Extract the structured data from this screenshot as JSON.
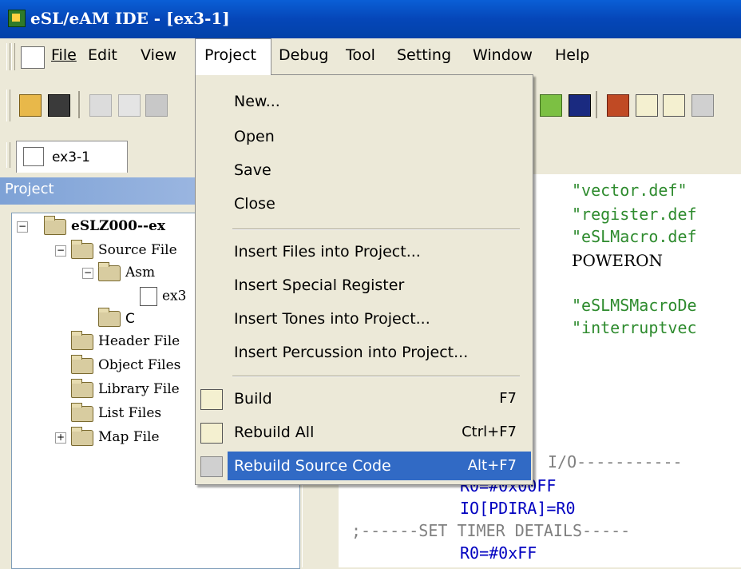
{
  "window": {
    "title": "eSL/eAM IDE - [ex3-1]"
  },
  "menubar": {
    "items": [
      "File",
      "Edit",
      "View",
      "Project",
      "Debug",
      "Tool",
      "Setting",
      "Window",
      "Help"
    ]
  },
  "doc_tab": {
    "label": "ex3-1"
  },
  "project_pane": {
    "title": "Project",
    "tree": [
      {
        "label": "eSLZ000--ex",
        "level": 0,
        "type": "folder",
        "expander": "−"
      },
      {
        "label": "Source File",
        "level": 1,
        "type": "folder",
        "expander": "−"
      },
      {
        "label": "Asm",
        "level": 2,
        "type": "folder",
        "expander": "−"
      },
      {
        "label": "ex3",
        "level": 3,
        "type": "file"
      },
      {
        "label": "C",
        "level": 2,
        "type": "folder"
      },
      {
        "label": "Header File",
        "level": 1,
        "type": "folder"
      },
      {
        "label": "Object Files",
        "level": 1,
        "type": "folder"
      },
      {
        "label": "Library File",
        "level": 1,
        "type": "folder"
      },
      {
        "label": "List Files",
        "level": 1,
        "type": "folder"
      },
      {
        "label": "Map File",
        "level": 1,
        "type": "folder",
        "expander": "+"
      }
    ]
  },
  "project_menu": {
    "items": [
      {
        "label": "New...",
        "shortcut": ""
      },
      {
        "label": "Open",
        "shortcut": ""
      },
      {
        "label": "Save",
        "shortcut": ""
      },
      {
        "label": "Close",
        "shortcut": ""
      },
      {
        "label": "Insert Files into Project...",
        "shortcut": ""
      },
      {
        "label": "Insert Special Register",
        "shortcut": ""
      },
      {
        "label": "Insert Tones into Project...",
        "shortcut": ""
      },
      {
        "label": "Insert Percussion into Project...",
        "shortcut": ""
      },
      {
        "label": "Build",
        "shortcut": "F7"
      },
      {
        "label": "Rebuild All",
        "shortcut": "Ctrl+F7"
      },
      {
        "label": "Rebuild Source Code",
        "shortcut": "Alt+F7"
      }
    ],
    "highlighted": "Rebuild Source Code"
  },
  "editor": {
    "lines": [
      {
        "text": "\"vector.def\"",
        "color": "#2e8b2e"
      },
      {
        "text": "\"register.def",
        "color": "#2e8b2e"
      },
      {
        "text": "\"eSLMacro.def",
        "color": "#2e8b2e"
      },
      {
        "text": "POWERON",
        "color": "#000000"
      },
      {
        "text": "\"eSLMSMacroDe",
        "color": "#2e8b2e"
      },
      {
        "text": "\"interruptvec",
        "color": "#2e8b2e"
      },
      {
        "text": "I/O-----------",
        "color": "#808080"
      },
      {
        "text": "R0=#0x00FF",
        "color": "#0000c0"
      },
      {
        "text": "IO[PDIRA]=R0",
        "color": "#0000c0"
      },
      {
        "text": ";------SET TIMER DETAILS-----",
        "color": "#808080"
      },
      {
        "text": "R0=#0xFF",
        "color": "#0000c0"
      }
    ]
  },
  "colors": {
    "title_bar": "#0a5fd6",
    "menu_highlight": "#316ac5",
    "string": "#2e8b2e",
    "register": "#0000c0"
  }
}
